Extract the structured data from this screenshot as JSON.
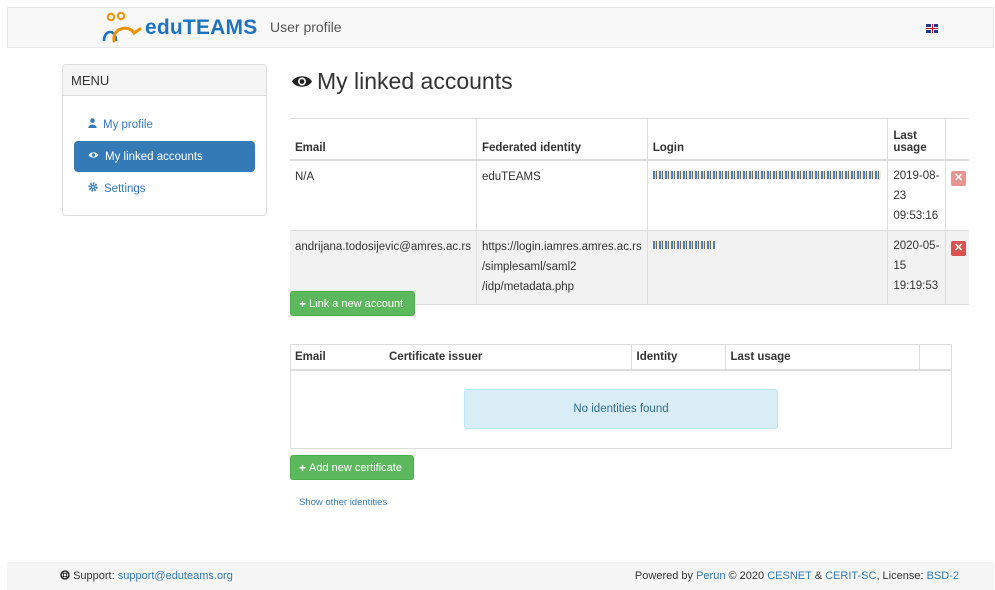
{
  "navbar": {
    "brand": "eduTEAMS",
    "title": "User profile",
    "language_icon": "uk-flag-icon"
  },
  "sidebar": {
    "heading": "MENU",
    "items": [
      {
        "label": "My profile",
        "icon": "user-icon",
        "active": false
      },
      {
        "label": "My linked accounts",
        "icon": "eye-icon",
        "active": true
      },
      {
        "label": "Settings",
        "icon": "gear-icon",
        "active": false
      }
    ]
  },
  "main": {
    "title": "My linked accounts",
    "accounts_table": {
      "columns": [
        "Email",
        "Federated identity",
        "Login",
        "Last usage",
        ""
      ],
      "rows": [
        {
          "email": "N/A",
          "federated_identity": [
            "eduTEAMS"
          ],
          "login_masked": true,
          "last_usage_date": "2019-08-23",
          "last_usage_time": "09:53:16",
          "remove_icon": "times-icon"
        },
        {
          "email": "andrijana.todosijevic@amres.ac.rs",
          "federated_identity": [
            "https://login.iamres.amres.ac.rs",
            "/simplesaml/saml2",
            "/idp/metadata.php"
          ],
          "login_masked": true,
          "last_usage_date": "2020-05-15",
          "last_usage_time": "19:19:53",
          "remove_icon": "times-icon"
        }
      ]
    },
    "link_account_button": "Link a new account",
    "certificates_table": {
      "columns": [
        "Email",
        "Certificate issuer",
        "Identity",
        "Last usage",
        ""
      ],
      "empty_message": "No identities found"
    },
    "add_certificate_button": "Add new certificate",
    "show_other_link": "Show other identities"
  },
  "footer": {
    "support_label": "Support:",
    "support_email": "support@eduteams.org",
    "powered_by_prefix": "Powered by",
    "perun": "Perun",
    "copyright": "© 2020",
    "cesnet": "CESNET",
    "amp": "&",
    "cerit": "CERIT-SC",
    "license_label": ", License:",
    "license": "BSD-2"
  }
}
